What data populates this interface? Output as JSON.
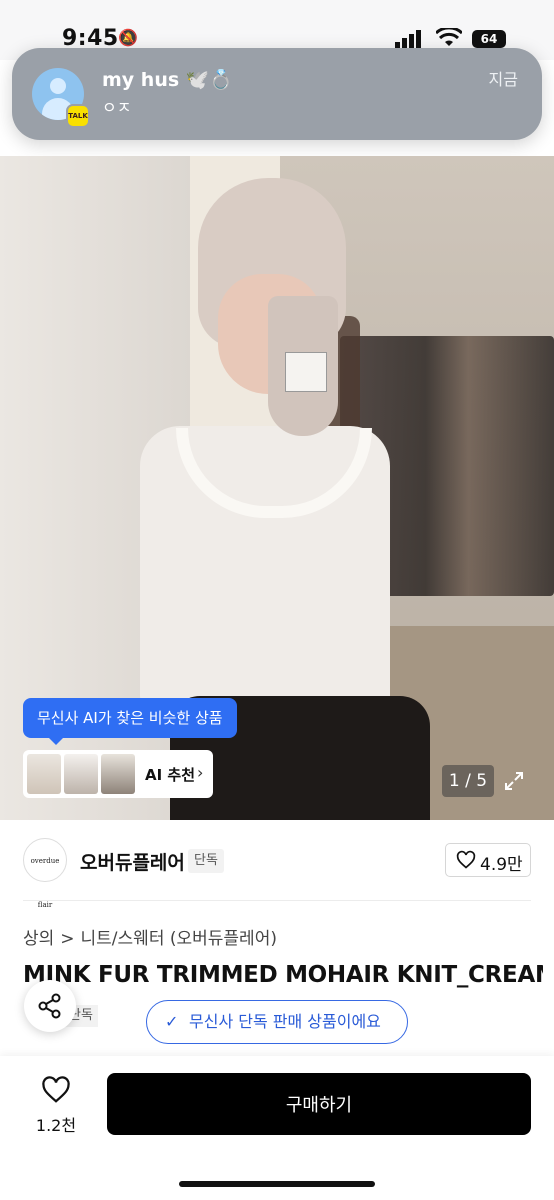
{
  "status_bar": {
    "time": "9:45",
    "battery": "64"
  },
  "notification": {
    "sender": "my hus 🕊️💍",
    "message": "ㅇㅈ",
    "time": "지금",
    "app_badge": "TALK"
  },
  "gallery": {
    "ai_tooltip": "무신사 AI가 찾은 비슷한 상품",
    "ai_label": "AI 추천",
    "counter": "1 / 5"
  },
  "brand": {
    "logo_text": "overdue flair",
    "name": "오버듀플레어",
    "badge": "단독",
    "likes": "4.9만"
  },
  "breadcrumb": [
    "상의",
    ">",
    "니트/스웨터 (오버듀플레어)"
  ],
  "product": {
    "title": "MINK FUR TRIMMED MOHAIR KNIT_CREAM",
    "badge": "단독",
    "exclusive_notice": "무신사 단독 판매 상품이에요"
  },
  "bottom_bar": {
    "wish_count": "1.2천",
    "buy_label": "구매하기"
  },
  "colors": {
    "accent_blue": "#2f6ef3",
    "buy_button": "#000000"
  }
}
